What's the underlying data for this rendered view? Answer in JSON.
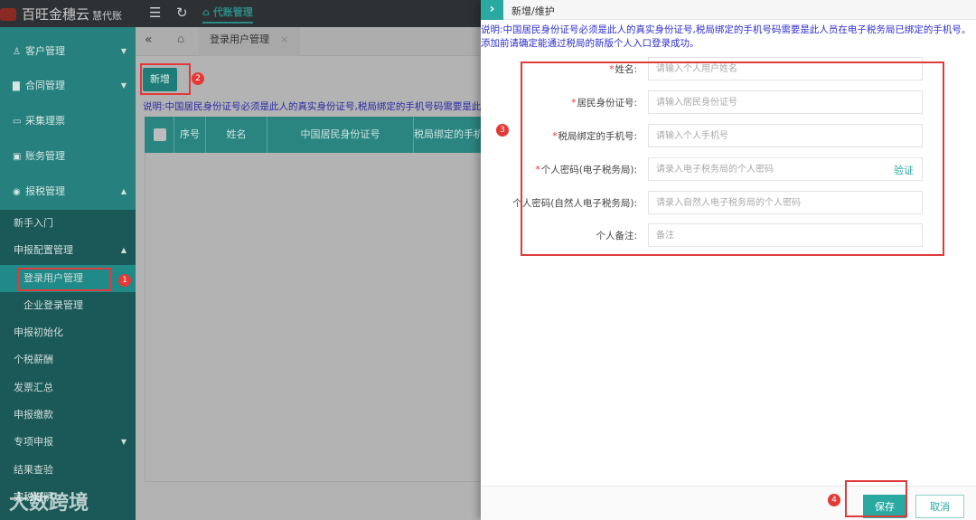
{
  "topbar": {
    "brand": "百旺金穗云",
    "brand_sub": "慧代账",
    "nav_tab": "代账管理"
  },
  "sidebar": {
    "items": [
      {
        "label": "客户管理",
        "icon": "user-icon"
      },
      {
        "label": "合同管理",
        "icon": "contract-icon"
      },
      {
        "label": "采集理票",
        "icon": "ticket-icon"
      },
      {
        "label": "账务管理",
        "icon": "ledger-icon"
      },
      {
        "label": "报税管理",
        "icon": "tax-icon"
      }
    ],
    "sub_items": [
      "新手入门",
      "申报配置管理",
      "登录用户管理",
      "企业登录管理",
      "申报初始化",
      "个税薪酬",
      "发票汇总",
      "申报缴款",
      "专项申报",
      "结果查验",
      "完税证明"
    ]
  },
  "watermark": "大数跨境",
  "tabs": {
    "active": "登录用户管理",
    "close": "×"
  },
  "main": {
    "add_button": "新增",
    "note": "说明:中国居民身份证号必须是此人的真实身份证号,税局绑定的手机号码需要是此人员在电子税务局已绑定的手机号。添加前请确定能通过税局的新版个人入口登录成功。",
    "columns": [
      "序号",
      "姓名",
      "中国居民身份证号",
      "税局绑定的手机号"
    ]
  },
  "panel": {
    "title": "新增/维护",
    "note": "说明:中国居民身份证号必须是此人的真实身份证号,税局绑定的手机号码需要是此人员在电子税务局已绑定的手机号。添加前请确定能通过税局的新版个人入口登录成功。",
    "fields": [
      {
        "label": "姓名:",
        "required": "*",
        "placeholder": "请输入个人用户姓名"
      },
      {
        "label": "居民身份证号:",
        "required": "*",
        "placeholder": "请输入居民身份证号"
      },
      {
        "label": "税局绑定的手机号:",
        "required": "*",
        "placeholder": "请输入个人手机号"
      },
      {
        "label": "个人密码(电子税务局):",
        "required": "*",
        "placeholder": "请录入电子税务局的个人密码"
      },
      {
        "label": "个人密码(自然人电子税务局):",
        "required": "",
        "placeholder": "请录入自然人电子税务局的个人密码"
      },
      {
        "label": "个人备注:",
        "required": "",
        "placeholder": "备注"
      }
    ],
    "verify": "验证",
    "save": "保存",
    "cancel": "取消"
  },
  "annotations": [
    "1",
    "2",
    "3",
    "4"
  ],
  "colors": {
    "accent": "#2aa8a2",
    "highlight": "#e03a3a",
    "note": "#2f2fd0"
  }
}
